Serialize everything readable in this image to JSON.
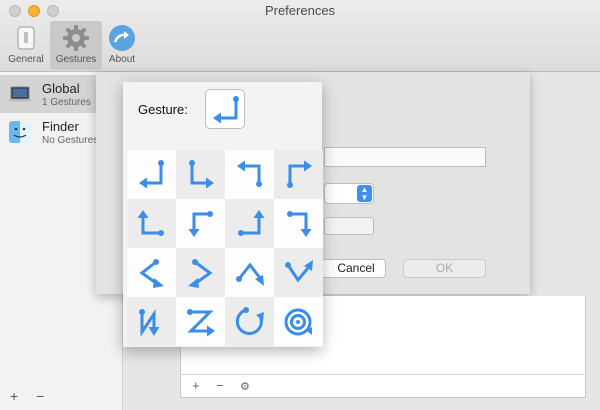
{
  "window": {
    "title": "Preferences"
  },
  "toolbar": {
    "items": [
      {
        "label": "General",
        "icon": "general-switch-icon"
      },
      {
        "label": "Gestures",
        "icon": "gestures-gear-icon",
        "selected": true
      },
      {
        "label": "About",
        "icon": "about-arrow-icon"
      }
    ]
  },
  "sidebar": {
    "items": [
      {
        "name": "Global",
        "subtitle": "1 Gestures",
        "icon": "laptop-icon",
        "selected": true
      },
      {
        "name": "Finder",
        "subtitle": "No Gestures",
        "icon": "finder-icon"
      }
    ],
    "footer": {
      "add": "+",
      "remove": "−"
    }
  },
  "editor": {
    "cancel_label": "Cancel",
    "ok_label": "OK",
    "list_footer": {
      "add": "+",
      "remove": "−",
      "settings": "⚙"
    }
  },
  "popover": {
    "label": "Gesture:",
    "current_gesture": "down-left-from-top",
    "gestures": [
      "down-left",
      "down-right",
      "left-down",
      "up-right",
      "up-right-from-bottom",
      "right-down",
      "up-left",
      "down-right-from-top",
      "left-right-chevron",
      "right-left-chevron",
      "up-down-chevron",
      "down-up-chevron",
      "n-shape",
      "z-shape",
      "circle-clockwise",
      "spiral"
    ]
  },
  "colors": {
    "accent": "#3a8ee6",
    "traffic_minimize": "#f5b634"
  }
}
